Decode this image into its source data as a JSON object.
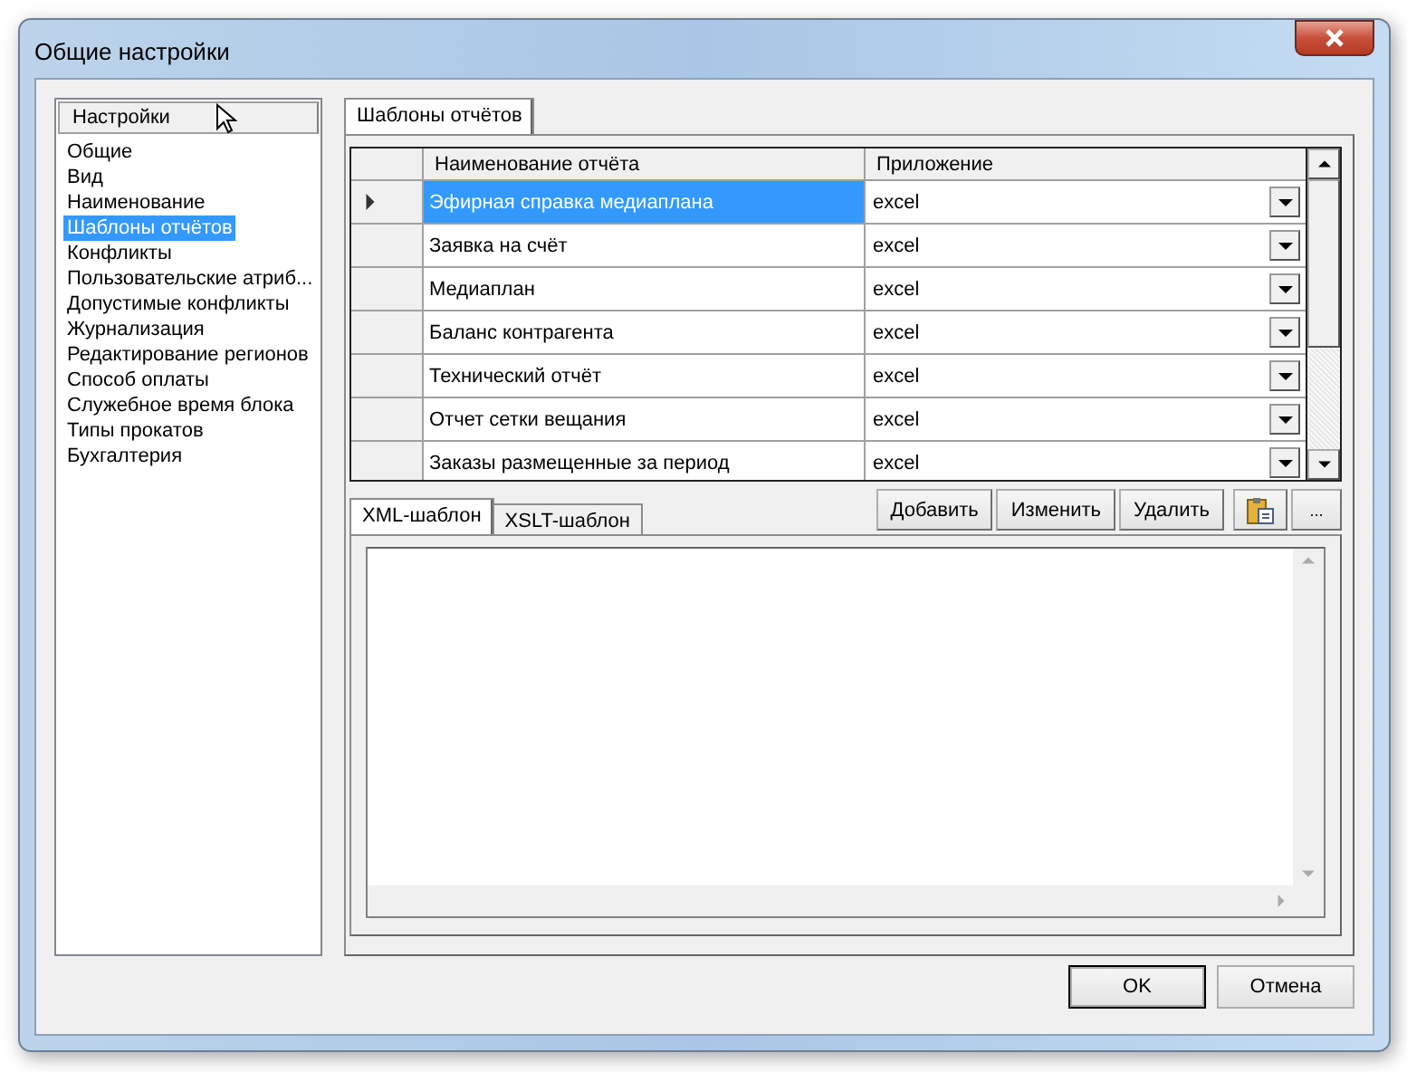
{
  "window": {
    "title": "Общие настройки"
  },
  "sidebar": {
    "header": "Настройки",
    "items": [
      {
        "label": "Общие",
        "selected": false
      },
      {
        "label": "Вид",
        "selected": false
      },
      {
        "label": "Наименование",
        "selected": false
      },
      {
        "label": "Шаблоны отчётов",
        "selected": true
      },
      {
        "label": "Конфликты",
        "selected": false
      },
      {
        "label": "Пользовательские атриб...",
        "selected": false
      },
      {
        "label": "Допустимые конфликты",
        "selected": false
      },
      {
        "label": "Журнализация",
        "selected": false
      },
      {
        "label": "Редактирование регионов",
        "selected": false
      },
      {
        "label": "Способ оплаты",
        "selected": false
      },
      {
        "label": "Служебное время блока",
        "selected": false
      },
      {
        "label": "Типы прокатов",
        "selected": false
      },
      {
        "label": "Бухгалтерия",
        "selected": false
      }
    ]
  },
  "main_tabs": [
    {
      "label": "Шаблоны отчётов",
      "selected": true
    }
  ],
  "grid": {
    "columns": [
      "Наименование отчёта",
      "Приложение"
    ],
    "rows": [
      {
        "name": "Эфирная справка медиаплана",
        "app": "excel",
        "selected": true
      },
      {
        "name": "Заявка на счёт",
        "app": "excel",
        "selected": false
      },
      {
        "name": "Медиаплан",
        "app": "excel",
        "selected": false
      },
      {
        "name": "Баланс контрагента",
        "app": "excel",
        "selected": false
      },
      {
        "name": "Технический отчёт",
        "app": "excel",
        "selected": false
      },
      {
        "name": "Отчет сетки вещания",
        "app": "excel",
        "selected": false
      },
      {
        "name": "Заказы размещенные за период",
        "app": "excel",
        "selected": false
      }
    ]
  },
  "template_tabs": [
    {
      "label": "XML-шаблон",
      "selected": true
    },
    {
      "label": "XSLT-шаблон",
      "selected": false
    }
  ],
  "toolbar_buttons": [
    {
      "kind": "text",
      "label": "Добавить"
    },
    {
      "kind": "text",
      "label": "Изменить"
    },
    {
      "kind": "text",
      "label": "Удалить"
    },
    {
      "kind": "paste"
    },
    {
      "kind": "text",
      "label": "..."
    }
  ],
  "footer_buttons": [
    {
      "label": "OK",
      "default": true
    },
    {
      "label": "Отмена",
      "default": false
    }
  ]
}
